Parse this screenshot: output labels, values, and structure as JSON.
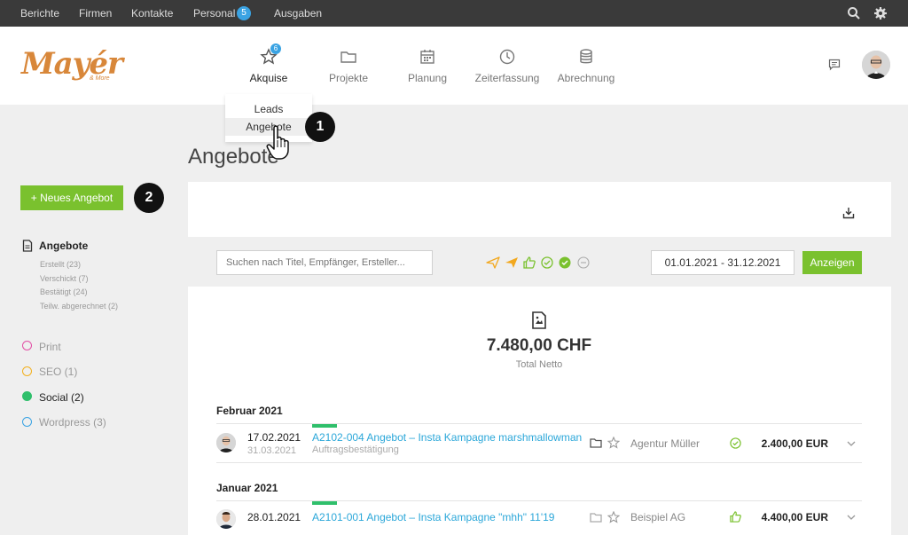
{
  "topnav": {
    "items": [
      "Berichte",
      "Firmen",
      "Kontakte",
      "Personal",
      "Ausgaben"
    ],
    "personal_badge": "5"
  },
  "header": {
    "logo": "Mayér",
    "logo_sub": "& More",
    "nav": [
      {
        "label": "Akquise",
        "icon": "star-icon",
        "badge": "6"
      },
      {
        "label": "Projekte",
        "icon": "folder-icon"
      },
      {
        "label": "Planung",
        "icon": "calendar-icon"
      },
      {
        "label": "Zeiterfassung",
        "icon": "clock-icon"
      },
      {
        "label": "Abrechnung",
        "icon": "database-icon"
      }
    ]
  },
  "dropdown": {
    "items": [
      "Leads",
      "Angebote"
    ]
  },
  "steps": [
    "1",
    "2"
  ],
  "page": {
    "title": "Angebote"
  },
  "sidebar": {
    "new_button": "+ Neues Angebot",
    "section_title": "Angebote",
    "sub_items": [
      "Erstellt (23)",
      "Verschickt (7)",
      "Bestätigt (24)",
      "Teilw. abgerechnet (2)"
    ],
    "tags": [
      {
        "label": "Print",
        "color": "#e24ea4",
        "filled": false
      },
      {
        "label": "SEO (1)",
        "color": "#f2b01e",
        "filled": false
      },
      {
        "label": "Social (2)",
        "color": "#2fbf6b",
        "filled": true
      },
      {
        "label": "Wordpress (3)",
        "color": "#3aa3e3",
        "filled": false
      }
    ]
  },
  "filters": {
    "search_placeholder": "Suchen nach Titel, Empfänger, Ersteller...",
    "date_range": "01.01.2021 - 31.12.2021",
    "show_button": "Anzeigen"
  },
  "summary": {
    "total_value": "7.480,00 CHF",
    "total_label": "Total Netto"
  },
  "groups": [
    {
      "month": "Februar 2021",
      "rows": [
        {
          "date": "17.02.2021",
          "date2": "31.03.2021",
          "title": "A2102-004 Angebot – Insta Kampagne marshmallowman",
          "subtitle": "Auftragsbestätigung",
          "company": "Agentur Müller",
          "amount": "2.400,00 EUR"
        }
      ]
    },
    {
      "month": "Januar 2021",
      "rows": [
        {
          "date": "28.01.2021",
          "title": "A2101-001 Angebot – Insta Kampagne \"mhh\" 11'19",
          "company": "Beispiel AG",
          "amount": "4.400,00 EUR"
        }
      ]
    }
  ],
  "colors": {
    "accent_green": "#7ac12e",
    "link_blue": "#2ba7d9",
    "status_green": "#2fbf6b",
    "topbar": "#3a3a3a"
  }
}
